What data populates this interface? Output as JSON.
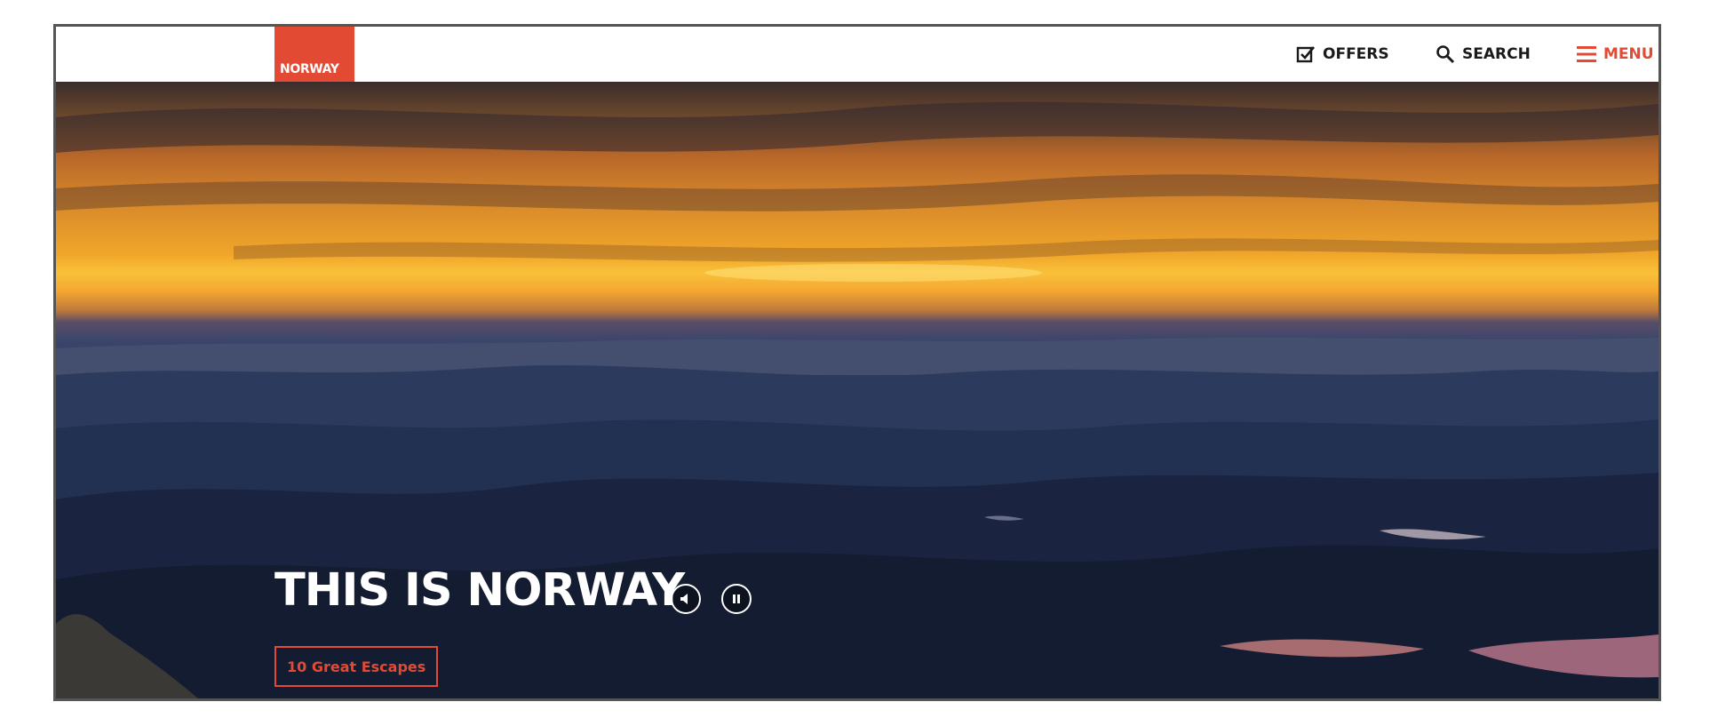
{
  "header": {
    "logo_text": "NORWAY",
    "nav": {
      "offers_label": "OFFERS",
      "search_label": "SEARCH",
      "menu_label": "MENU"
    },
    "icons": {
      "offers": "checkbox-icon",
      "search": "search-icon",
      "menu": "hamburger-icon"
    }
  },
  "hero": {
    "title": "THIS IS NORWAY",
    "cta_label": "10 Great Escapes",
    "controls": {
      "sound": "speaker-icon",
      "pause": "pause-icon"
    }
  },
  "colors": {
    "brand_red": "#e24a33",
    "frame_border": "#555555"
  }
}
